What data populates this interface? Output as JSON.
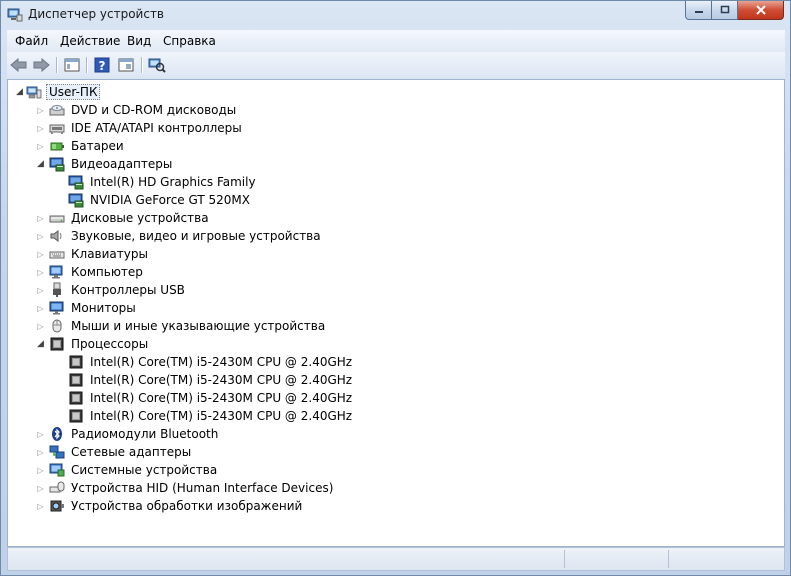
{
  "window": {
    "title": "Диспетчер устройств"
  },
  "menu": [
    "Файл",
    "Действие",
    "Вид",
    "Справка"
  ],
  "toolbar": [
    "back-icon",
    "forward-icon",
    "show-hide-tree-icon",
    "help-icon",
    "properties-icon",
    "scan-hardware-icon"
  ],
  "tree": [
    {
      "label": "User-ПК",
      "level": 0,
      "expander": "open",
      "icon": "computer-icon",
      "root": true
    },
    {
      "label": "DVD и CD-ROM дисководы",
      "level": 1,
      "expander": "closed",
      "icon": "dvd-drive-icon"
    },
    {
      "label": "IDE ATA/ATAPI контроллеры",
      "level": 1,
      "expander": "closed",
      "icon": "ide-controller-icon"
    },
    {
      "label": "Батареи",
      "level": 1,
      "expander": "closed",
      "icon": "battery-icon"
    },
    {
      "label": "Видеоадаптеры",
      "level": 1,
      "expander": "open",
      "icon": "display-adapter-icon"
    },
    {
      "label": "Intel(R) HD Graphics Family",
      "level": 2,
      "expander": "none",
      "icon": "display-adapter-icon"
    },
    {
      "label": "NVIDIA GeForce GT 520MX",
      "level": 2,
      "expander": "none",
      "icon": "display-adapter-icon"
    },
    {
      "label": "Дисковые устройства",
      "level": 1,
      "expander": "closed",
      "icon": "disk-drive-icon"
    },
    {
      "label": "Звуковые, видео и игровые устройства",
      "level": 1,
      "expander": "closed",
      "icon": "speaker-icon"
    },
    {
      "label": "Клавиатуры",
      "level": 1,
      "expander": "closed",
      "icon": "keyboard-icon"
    },
    {
      "label": "Компьютер",
      "level": 1,
      "expander": "closed",
      "icon": "computer-monitor-icon"
    },
    {
      "label": "Контроллеры USB",
      "level": 1,
      "expander": "closed",
      "icon": "usb-icon"
    },
    {
      "label": "Мониторы",
      "level": 1,
      "expander": "closed",
      "icon": "monitor-icon"
    },
    {
      "label": "Мыши и иные указывающие устройства",
      "level": 1,
      "expander": "closed",
      "icon": "mouse-icon"
    },
    {
      "label": "Процессоры",
      "level": 1,
      "expander": "open",
      "icon": "processor-icon"
    },
    {
      "label": "Intel(R) Core(TM) i5-2430M CPU @ 2.40GHz",
      "level": 2,
      "expander": "none",
      "icon": "processor-icon"
    },
    {
      "label": "Intel(R) Core(TM) i5-2430M CPU @ 2.40GHz",
      "level": 2,
      "expander": "none",
      "icon": "processor-icon"
    },
    {
      "label": "Intel(R) Core(TM) i5-2430M CPU @ 2.40GHz",
      "level": 2,
      "expander": "none",
      "icon": "processor-icon"
    },
    {
      "label": "Intel(R) Core(TM) i5-2430M CPU @ 2.40GHz",
      "level": 2,
      "expander": "none",
      "icon": "processor-icon"
    },
    {
      "label": "Радиомодули Bluetooth",
      "level": 1,
      "expander": "closed",
      "icon": "bluetooth-icon"
    },
    {
      "label": "Сетевые адаптеры",
      "level": 1,
      "expander": "closed",
      "icon": "network-adapter-icon"
    },
    {
      "label": "Системные устройства",
      "level": 1,
      "expander": "closed",
      "icon": "system-device-icon"
    },
    {
      "label": "Устройства HID (Human Interface Devices)",
      "level": 1,
      "expander": "closed",
      "icon": "hid-icon"
    },
    {
      "label": "Устройства обработки изображений",
      "level": 1,
      "expander": "closed",
      "icon": "imaging-device-icon"
    }
  ]
}
